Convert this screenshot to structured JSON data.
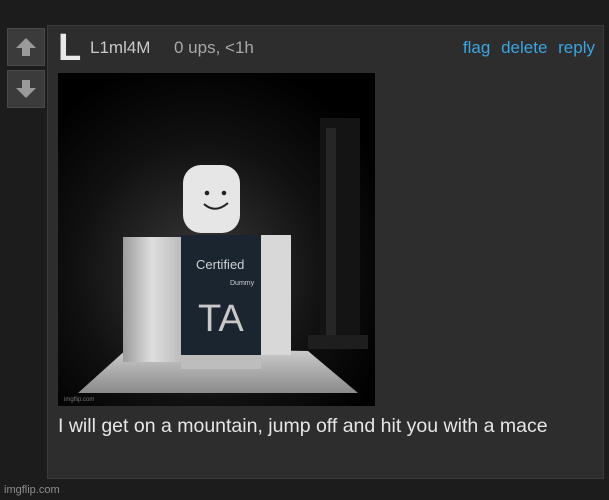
{
  "comment": {
    "avatar_letter": "L",
    "username": "L1ml4M",
    "meta": "0 ups, <1h",
    "actions": {
      "flag": "flag",
      "delete": "delete",
      "reply": "reply"
    },
    "text": "I will get on a mountain, jump off and hit you with a mace"
  },
  "meme_image": {
    "shirt_line1": "Certified",
    "shirt_line2": "Dummy",
    "shirt_letters": "TA",
    "inner_watermark": "imgflip.com"
  },
  "footer": {
    "watermark": "imgflip.com"
  },
  "colors": {
    "background": "#1c1c1c",
    "card": "#2d2d2d",
    "link": "#3aa5e0",
    "text": "#e6e6e6"
  },
  "icons": {
    "upvote": "arrow-up-icon",
    "downvote": "arrow-down-icon"
  }
}
